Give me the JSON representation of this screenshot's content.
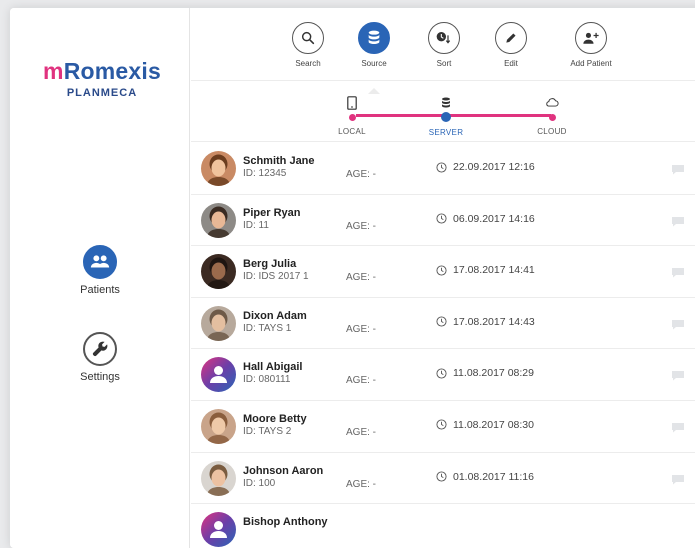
{
  "app": {
    "logo_main": "mRomexis",
    "logo_sub": "PLANMECA"
  },
  "sidebar": {
    "items": [
      {
        "label": "Patients",
        "active": true
      },
      {
        "label": "Settings",
        "active": false
      }
    ]
  },
  "toolbar": {
    "tools": [
      {
        "label": "Search",
        "icon": "search-icon"
      },
      {
        "label": "Source",
        "icon": "database-icon",
        "active": true
      },
      {
        "label": "Sort",
        "icon": "sort-icon"
      },
      {
        "label": "Edit",
        "icon": "pencil-icon"
      },
      {
        "label": "Add Patient",
        "icon": "add-person-icon"
      }
    ]
  },
  "source": {
    "options": [
      {
        "label": "LOCAL",
        "icon": "tablet-icon"
      },
      {
        "label": "SERVER",
        "icon": "database-icon",
        "active": true
      },
      {
        "label": "CLOUD",
        "icon": "cloud-icon"
      }
    ]
  },
  "patients": [
    {
      "name": "Schmith Jane",
      "id": "ID: 12345",
      "age": "AGE: -",
      "date": "22.09.2017 12:16"
    },
    {
      "name": "Piper Ryan",
      "id": "ID: 11",
      "age": "AGE: -",
      "date": "06.09.2017 14:16"
    },
    {
      "name": "Berg Julia",
      "id": "ID: IDS 2017 1",
      "age": "AGE: -",
      "date": "17.08.2017 14:41"
    },
    {
      "name": "Dixon Adam",
      "id": "ID: TAYS 1",
      "age": "AGE: -",
      "date": "17.08.2017 14:43"
    },
    {
      "name": "Hall Abigail",
      "id": "ID: 080111",
      "age": "AGE: -",
      "date": "11.08.2017 08:29"
    },
    {
      "name": "Moore Betty",
      "id": "ID: TAYS 2",
      "age": "AGE: -",
      "date": "11.08.2017 08:30"
    },
    {
      "name": "Johnson Aaron",
      "id": "ID: 100",
      "age": "AGE: -",
      "date": "01.08.2017 11:16"
    },
    {
      "name": "Bishop Anthony",
      "id": "",
      "age": "",
      "date": ""
    }
  ],
  "colors": {
    "accent_blue": "#2a65b6",
    "accent_pink": "#e0337f"
  }
}
